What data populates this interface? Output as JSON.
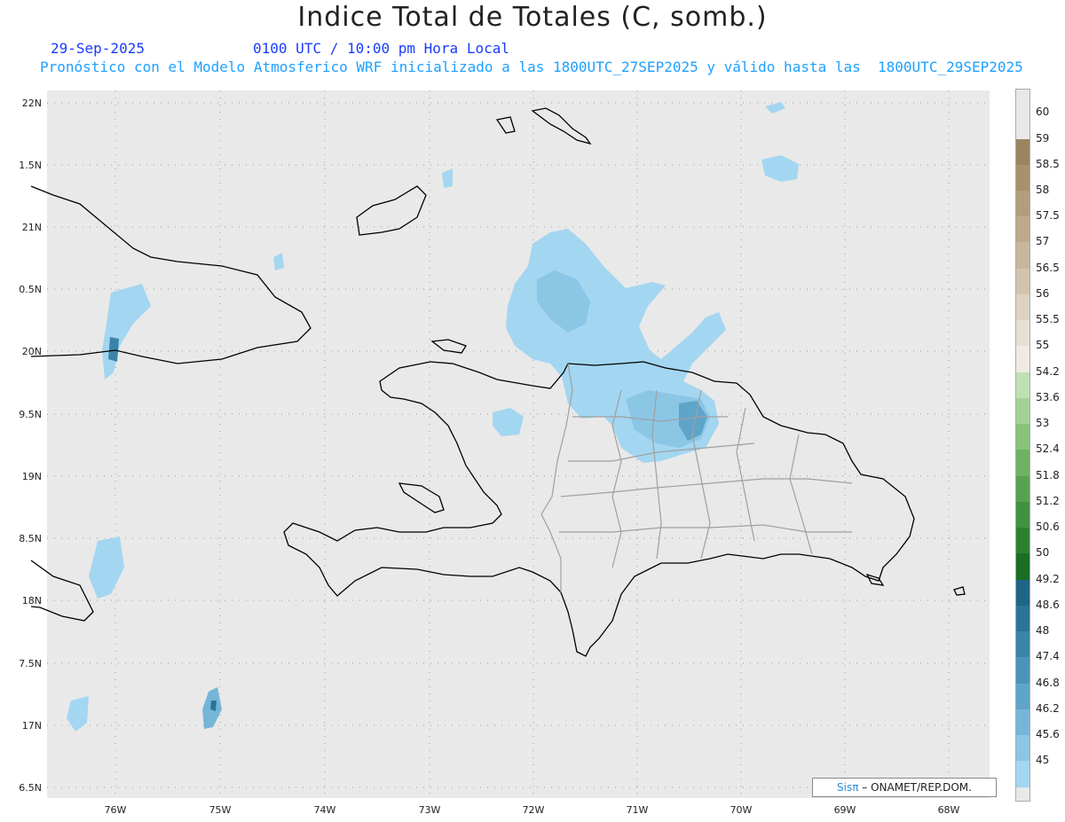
{
  "title": "Indice Total de Totales (C, somb.)",
  "header": {
    "date": "29-Sep-2025",
    "time": "0100 UTC / 10:00 pm Hora Local",
    "subtitle": "Pronóstico con el Modelo Atmosferico WRF inicializado a las 1800UTC_27SEP2025 y válido hasta las  1800UTC_29SEP2025"
  },
  "map": {
    "lat_labels": [
      "22N",
      "1.5N",
      "21N",
      "0.5N",
      "20N",
      "9.5N",
      "19N",
      "8.5N",
      "18N",
      "7.5N",
      "17N",
      "6.5N"
    ],
    "lon_labels": [
      "76W",
      "75W",
      "74W",
      "73W",
      "72W",
      "71W",
      "70W",
      "69W",
      "68W"
    ],
    "background_color": "#e9e9e9"
  },
  "credit": {
    "brand": "Sis",
    "pi": "π",
    "text": " – ONAMET/REP.DOM."
  },
  "legend": {
    "levels": [
      {
        "label": "60",
        "color": "#e8e8e8"
      },
      {
        "label": "59",
        "color": "#9a8560"
      },
      {
        "label": "58.5",
        "color": "#a8916c"
      },
      {
        "label": "58",
        "color": "#b39e7b"
      },
      {
        "label": "57.5",
        "color": "#bea98a"
      },
      {
        "label": "57",
        "color": "#c8b79c"
      },
      {
        "label": "56.5",
        "color": "#d2c4ae"
      },
      {
        "label": "56",
        "color": "#ddd2c1"
      },
      {
        "label": "55.5",
        "color": "#e7dfd3"
      },
      {
        "label": "55",
        "color": "#efeae2"
      },
      {
        "label": "54.2",
        "color": "#bfe0b3"
      },
      {
        "label": "53.6",
        "color": "#a3d196"
      },
      {
        "label": "53",
        "color": "#88c27b"
      },
      {
        "label": "52.4",
        "color": "#6fb264"
      },
      {
        "label": "51.8",
        "color": "#57a24f"
      },
      {
        "label": "51.2",
        "color": "#419240"
      },
      {
        "label": "50.6",
        "color": "#2c8130"
      },
      {
        "label": "50",
        "color": "#197023"
      },
      {
        "label": "49.2",
        "color": "#1f6585"
      },
      {
        "label": "48.6",
        "color": "#2b7497"
      },
      {
        "label": "48",
        "color": "#3a84a8"
      },
      {
        "label": "47.4",
        "color": "#4b94b9"
      },
      {
        "label": "46.8",
        "color": "#5fa5c9"
      },
      {
        "label": "46.2",
        "color": "#75b6d8"
      },
      {
        "label": "45.6",
        "color": "#8bc6e5"
      },
      {
        "label": "45",
        "color": "#a3d6f1"
      }
    ]
  }
}
